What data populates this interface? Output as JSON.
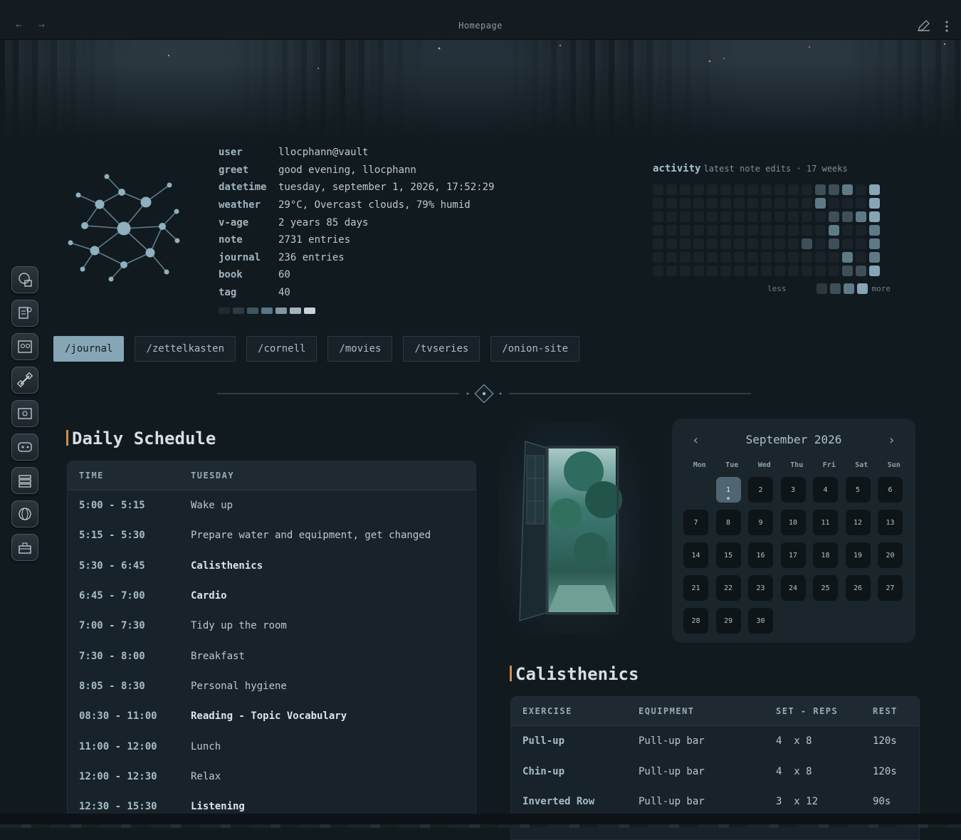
{
  "titlebar": {
    "title": "Homepage"
  },
  "profile": [
    {
      "key": "user",
      "value": "llocphann@vault"
    },
    {
      "key": "greet",
      "value": "good evening, llocphann"
    },
    {
      "key": "datetime",
      "value": "tuesday, september 1, 2026, 17:52:29"
    },
    {
      "key": "weather",
      "value": "29°C, Overcast clouds, 79% humid"
    },
    {
      "key": "v-age",
      "value": "2 years 85 days"
    },
    {
      "key": "note",
      "value": "2731 entries"
    },
    {
      "key": "journal",
      "value": "236 entries"
    },
    {
      "key": "book",
      "value": "60"
    },
    {
      "key": "tag",
      "value": "40"
    }
  ],
  "palette": [
    "#1f2a30",
    "#2c3a42",
    "#3f5560",
    "#5a7684",
    "#7f98a4",
    "#a4b4bc",
    "#c9d2d6"
  ],
  "activity": {
    "title": "activity",
    "subtitle": "latest note edits · 17 weeks",
    "legend_less": "less",
    "legend_more": "more",
    "legend_colors": [
      "#2c383f",
      "#3e4f58",
      "#5f7a87",
      "#86a6b6"
    ],
    "grid_levels": [
      [
        0,
        0,
        0,
        0,
        0,
        0,
        0,
        0,
        0,
        0,
        0,
        0,
        2,
        2,
        3,
        0,
        4
      ],
      [
        0,
        0,
        0,
        0,
        0,
        0,
        0,
        0,
        0,
        0,
        0,
        0,
        3,
        0,
        0,
        0,
        4
      ],
      [
        0,
        0,
        0,
        0,
        0,
        0,
        0,
        0,
        0,
        0,
        0,
        0,
        0,
        2,
        2,
        3,
        4
      ],
      [
        0,
        0,
        0,
        0,
        0,
        0,
        0,
        0,
        0,
        0,
        0,
        0,
        0,
        3,
        0,
        0,
        3
      ],
      [
        0,
        0,
        0,
        0,
        0,
        0,
        0,
        0,
        0,
        0,
        0,
        2,
        0,
        2,
        0,
        0,
        3
      ],
      [
        0,
        0,
        0,
        0,
        0,
        0,
        0,
        0,
        0,
        0,
        0,
        0,
        0,
        0,
        3,
        0,
        3
      ],
      [
        0,
        0,
        0,
        0,
        0,
        0,
        0,
        0,
        0,
        0,
        0,
        0,
        0,
        0,
        2,
        2,
        4
      ]
    ]
  },
  "tabs": [
    "/journal",
    "/zettelkasten",
    "/cornell",
    "/movies",
    "/tvseries",
    "/onion-site"
  ],
  "schedule": {
    "title": "Daily Schedule",
    "headers": [
      "TIME",
      "TUESDAY"
    ],
    "rows": [
      {
        "time": "5:00 - 5:15",
        "activity": "Wake up",
        "bold": false
      },
      {
        "time": "5:15 - 5:30",
        "activity": "Prepare water and equipment, get changed",
        "bold": false
      },
      {
        "time": "5:30 - 6:45",
        "activity": "Calisthenics",
        "bold": true
      },
      {
        "time": "6:45 - 7:00",
        "activity": "Cardio",
        "bold": true
      },
      {
        "time": "7:00 - 7:30",
        "activity": "Tidy up the room",
        "bold": false
      },
      {
        "time": "7:30 - 8:00",
        "activity": "Breakfast",
        "bold": false
      },
      {
        "time": "8:05 - 8:30",
        "activity": "Personal hygiene",
        "bold": false
      },
      {
        "time": "08:30 - 11:00",
        "activity": "Reading - Topic Vocabulary",
        "bold": true
      },
      {
        "time": "11:00 - 12:00",
        "activity": "Lunch",
        "bold": false
      },
      {
        "time": "12:00 - 12:30",
        "activity": "Relax",
        "bold": false
      },
      {
        "time": "12:30 - 15:30",
        "activity": "Listening",
        "bold": true
      }
    ]
  },
  "calendar": {
    "title": "September 2026",
    "prev": "‹",
    "next": "›",
    "weekdays": [
      "Mon",
      "Tue",
      "Wed",
      "Thu",
      "Fri",
      "Sat",
      "Sun"
    ],
    "leading_blanks": 1,
    "days": 30,
    "today": 1
  },
  "calisthenics": {
    "title": "Calisthenics",
    "headers": [
      "EXERCISE",
      "EQUIPMENT",
      "SET - REPS",
      "REST"
    ],
    "rows": [
      {
        "exercise": "Pull-up",
        "equipment": "Pull-up bar",
        "sets": "4  x 8",
        "rest": "120s"
      },
      {
        "exercise": "Chin-up",
        "equipment": "Pull-up bar",
        "sets": "4  x 8",
        "rest": "120s"
      },
      {
        "exercise": "Inverted Row",
        "equipment": "Pull-up bar",
        "sets": "3  x 12",
        "rest": "90s"
      }
    ]
  }
}
